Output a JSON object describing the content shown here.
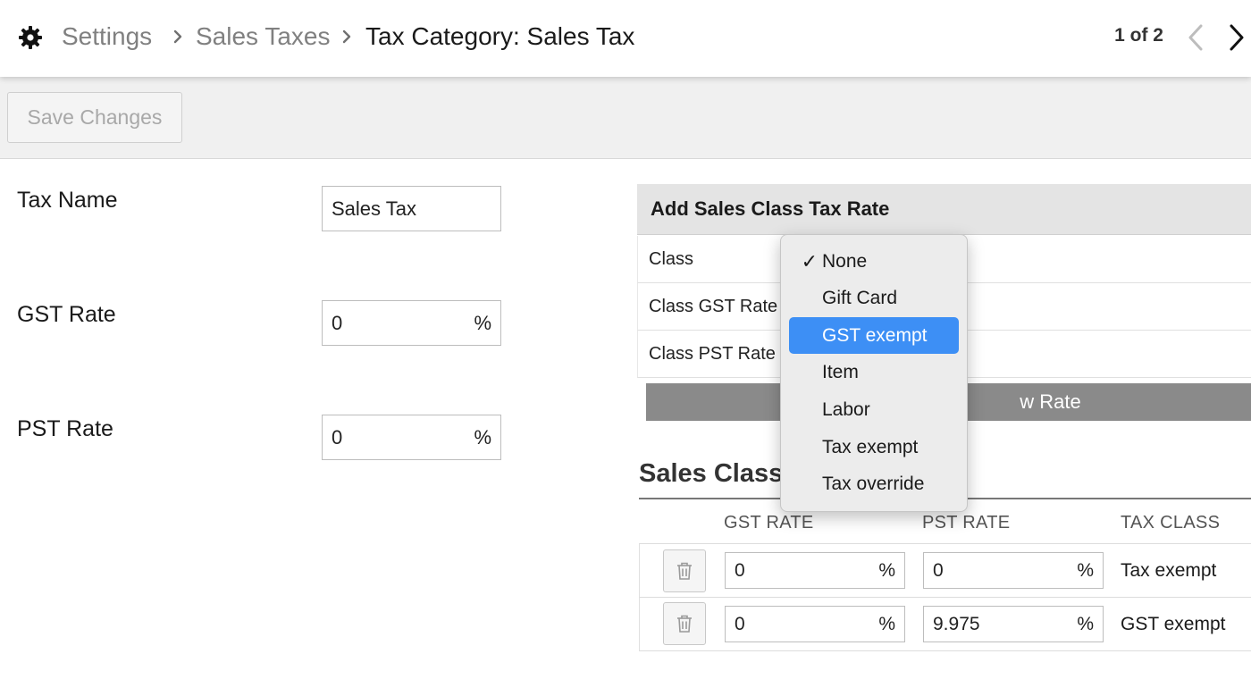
{
  "breadcrumb": {
    "items": [
      {
        "label": "Settings"
      },
      {
        "label": "Sales Taxes"
      },
      {
        "label": "Tax Category: Sales Tax"
      }
    ]
  },
  "pager": {
    "text": "1 of 2"
  },
  "toolbar": {
    "save_label": "Save Changes"
  },
  "form": {
    "tax_name_label": "Tax Name",
    "tax_name_value": "Sales Tax",
    "gst_label": "GST Rate",
    "gst_value": "0",
    "pst_label": "PST Rate",
    "pst_value": "0",
    "percent": "%"
  },
  "add_panel": {
    "title": "Add Sales Class Tax Rate",
    "class_label": "Class",
    "class_gst_label": "Class GST Rate",
    "class_pst_label": "Class PST Rate",
    "add_button_visible_text": "w Rate"
  },
  "table": {
    "title_visible": "Sales Class T",
    "headers": [
      "GST RATE",
      "PST RATE",
      "TAX CLASS"
    ],
    "rows": [
      {
        "gst": "0",
        "pst": "0",
        "tax_class": "Tax exempt"
      },
      {
        "gst": "0",
        "pst": "9.975",
        "tax_class": "GST exempt"
      }
    ]
  },
  "dropdown": {
    "checked_index": 0,
    "highlighted_index": 2,
    "options": [
      "None",
      "Gift Card",
      "GST exempt",
      "Item",
      "Labor",
      "Tax exempt",
      "Tax override"
    ]
  },
  "colors": {
    "accent": "#3d8ff5",
    "button_gray": "#8a8a8a",
    "muted_text": "#808080"
  },
  "icons": {
    "gear": "gear-icon",
    "breadcrumb_separator": "chevron-right-icon",
    "pager_prev": "chevron-left-icon",
    "pager_next": "chevron-right-icon",
    "delete": "trash-icon",
    "check": "checkmark-icon"
  }
}
